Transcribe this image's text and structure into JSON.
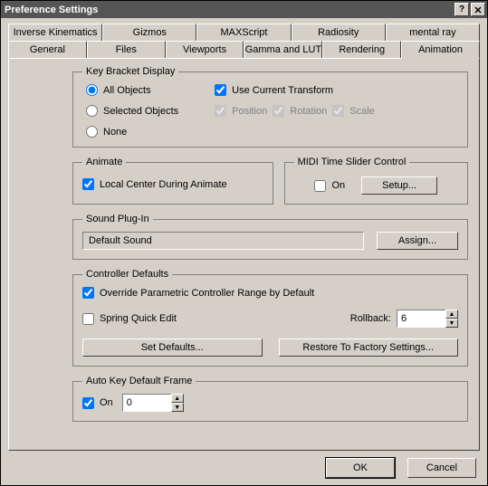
{
  "window": {
    "title": "Preference Settings"
  },
  "tabs_row1": [
    "Inverse Kinematics",
    "Gizmos",
    "MAXScript",
    "Radiosity",
    "mental ray"
  ],
  "tabs_row2": [
    "General",
    "Files",
    "Viewports",
    "Gamma and LUT",
    "Rendering",
    "Animation"
  ],
  "key_bracket": {
    "legend": "Key Bracket Display",
    "all_objects": "All Objects",
    "selected_objects": "Selected Objects",
    "none": "None",
    "use_current_transform": "Use Current Transform",
    "position": "Position",
    "rotation": "Rotation",
    "scale": "Scale",
    "use_current_transform_checked": true,
    "selected": "all"
  },
  "animate": {
    "legend": "Animate",
    "local_center": "Local Center During Animate",
    "local_center_checked": true
  },
  "midi": {
    "legend": "MIDI Time Slider Control",
    "on_label": "On",
    "on_checked": false,
    "setup_label": "Setup..."
  },
  "sound": {
    "legend": "Sound Plug-In",
    "current": "Default Sound",
    "assign_label": "Assign..."
  },
  "controller": {
    "legend": "Controller Defaults",
    "override": "Override Parametric Controller Range by Default",
    "override_checked": true,
    "spring": "Spring Quick Edit",
    "spring_checked": false,
    "rollback_label": "Rollback:",
    "rollback_value": "6",
    "set_defaults": "Set Defaults...",
    "restore": "Restore To Factory Settings..."
  },
  "autokey": {
    "legend": "Auto Key Default Frame",
    "on_label": "On",
    "on_checked": true,
    "value": "0"
  },
  "buttons": {
    "ok": "OK",
    "cancel": "Cancel"
  }
}
